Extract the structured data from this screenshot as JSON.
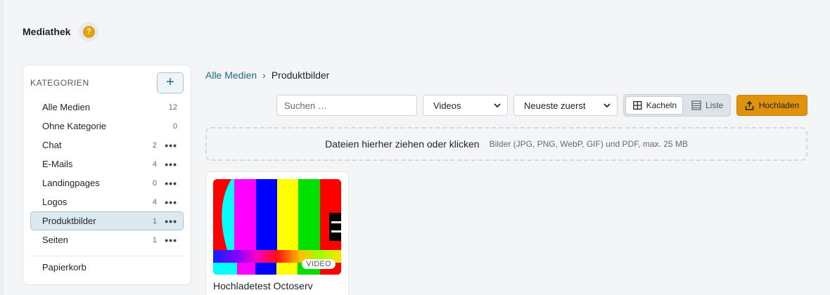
{
  "header": {
    "title": "Mediathek",
    "help_glyph": "?"
  },
  "sidebar": {
    "title": "KATEGORIEN",
    "add_label": "+",
    "categories": [
      {
        "label": "Alle Medien",
        "count": "12",
        "has_menu": false
      },
      {
        "label": "Ohne Kategorie",
        "count": "0",
        "has_menu": false
      },
      {
        "label": "Chat",
        "count": "2",
        "has_menu": true
      },
      {
        "label": "E-Mails",
        "count": "4",
        "has_menu": true
      },
      {
        "label": "Landingpages",
        "count": "0",
        "has_menu": true
      },
      {
        "label": "Logos",
        "count": "4",
        "has_menu": true
      },
      {
        "label": "Produktbilder",
        "count": "1",
        "has_menu": true,
        "active": true
      },
      {
        "label": "Seiten",
        "count": "1",
        "has_menu": true
      }
    ],
    "trash_label": "Papierkorb",
    "menu_glyph": "•••"
  },
  "breadcrumb": {
    "root": "Alle Medien",
    "separator": "›",
    "current": "Produktbilder"
  },
  "toolbar": {
    "search_placeholder": "Suchen …",
    "type_filter": "Videos",
    "sort": "Neueste zuerst",
    "view_tiles": "Kacheln",
    "view_list": "Liste",
    "upload": "Hochladen"
  },
  "dropzone": {
    "main": "Dateien hierher ziehen oder klicken",
    "hint": "Bilder (JPG, PNG, WebP, GIF) und PDF, max. 25 MB"
  },
  "media": [
    {
      "title": "Hochladetest Octoserv",
      "badge": "VIDEO"
    }
  ],
  "colors": {
    "accent": "#1a6b8c",
    "upload": "#e0920b",
    "help": "#e0a00b",
    "active_bg": "#dde9f0"
  }
}
